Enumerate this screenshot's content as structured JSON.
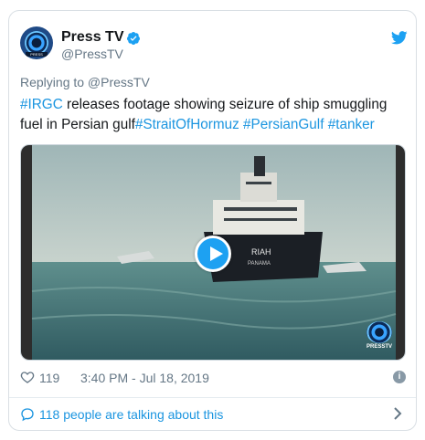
{
  "header": {
    "display_name": "Press TV",
    "handle": "@PressTV",
    "avatar_icon": "press-tv-logo",
    "verified_icon": "verified-badge-icon",
    "platform_icon": "twitter-bird-icon"
  },
  "replying_to": "Replying to @PressTV",
  "tweet": {
    "segments": [
      {
        "text": "#IRGC",
        "hashtag": true
      },
      {
        "text": " releases footage showing seizure of ship smuggling fuel in Persian gulf",
        "hashtag": false
      },
      {
        "text": "#StraitOfHormuz",
        "hashtag": true
      },
      {
        "text": " ",
        "hashtag": false
      },
      {
        "text": "#PersianGulf",
        "hashtag": true
      },
      {
        "text": " ",
        "hashtag": false
      },
      {
        "text": "#tanker",
        "hashtag": true
      }
    ]
  },
  "media": {
    "type": "video",
    "play_icon": "play-icon",
    "ship_name": "RIAH",
    "ship_port": "PANAMA",
    "watermark": "PRESSTV"
  },
  "meta": {
    "likes": "119",
    "timestamp": "3:40 PM - Jul 18, 2019",
    "info_icon": "info-icon"
  },
  "footer": {
    "talking_text": "118 people are talking about this"
  },
  "colors": {
    "link": "#1b95e0",
    "text": "#14171a",
    "secondary": "#657786",
    "border": "#d9dfe4"
  }
}
